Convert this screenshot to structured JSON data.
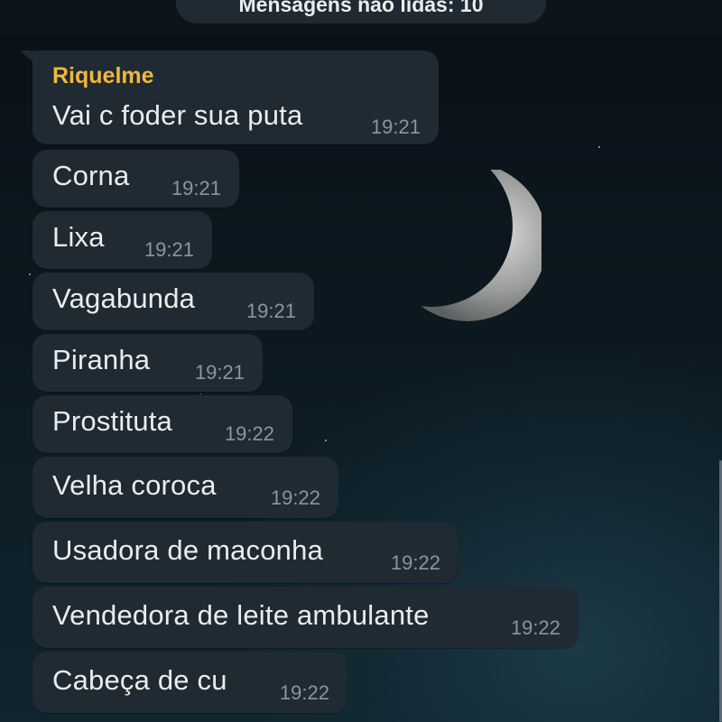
{
  "header": {
    "unread_banner": "Mensagens não lidas: 10"
  },
  "chat": {
    "sender": "Riquelme",
    "messages": [
      {
        "text": "Vai c foder sua puta",
        "time": "19:21"
      },
      {
        "text": "Corna",
        "time": "19:21"
      },
      {
        "text": "Lixa",
        "time": "19:21"
      },
      {
        "text": "Vagabunda",
        "time": "19:21"
      },
      {
        "text": "Piranha",
        "time": "19:21"
      },
      {
        "text": "Prostituta",
        "time": "19:22"
      },
      {
        "text": "Velha coroca",
        "time": "19:22"
      },
      {
        "text": "Usadora de maconha",
        "time": "19:22"
      },
      {
        "text": "Vendedora de leite ambulante",
        "time": "19:22"
      },
      {
        "text": "Cabeça de cu",
        "time": "19:22"
      }
    ]
  },
  "colors": {
    "bubble": "#1f2a33",
    "sender_name": "#f2b83c",
    "message_text": "#e9edef",
    "timestamp": "#8a979f"
  },
  "wallpaper": "night-sky-crescent-moon"
}
